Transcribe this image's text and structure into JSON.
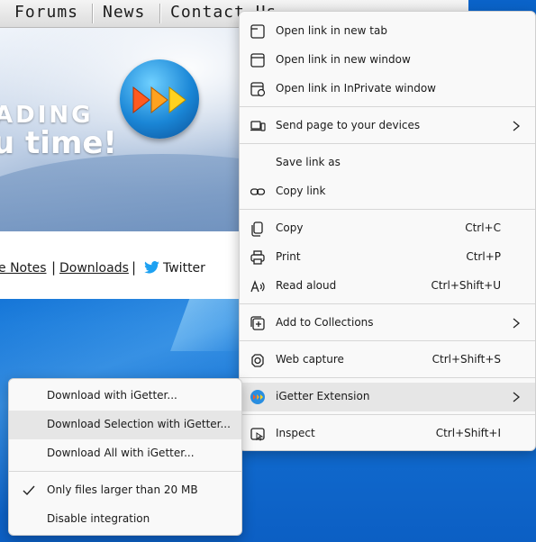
{
  "page": {
    "nav": [
      "Forums",
      "News",
      "Contact Us"
    ],
    "banner_line1": "ADING",
    "banner_line2": "u time!",
    "links": [
      "e Notes",
      "Downloads",
      "Twitter"
    ]
  },
  "context_menu": {
    "items": [
      {
        "label": "Open link in new tab",
        "icon": "new-tab-icon"
      },
      {
        "label": "Open link in new window",
        "icon": "new-window-icon"
      },
      {
        "label": "Open link in InPrivate window",
        "icon": "inprivate-icon"
      },
      {
        "label": "Send page to your devices",
        "icon": "devices-icon"
      },
      {
        "label": "Save link as"
      },
      {
        "label": "Copy link",
        "icon": "link-icon"
      },
      {
        "label": "Copy",
        "shortcut": "Ctrl+C",
        "icon": "copy-icon"
      },
      {
        "label": "Print",
        "shortcut": "Ctrl+P",
        "icon": "print-icon"
      },
      {
        "label": "Read aloud",
        "shortcut": "Ctrl+Shift+U",
        "icon": "read-aloud-icon"
      },
      {
        "label": "Add to Collections",
        "icon": "collections-icon"
      },
      {
        "label": "Web capture",
        "shortcut": "Ctrl+Shift+S",
        "icon": "web-capture-icon"
      },
      {
        "label": "iGetter Extension",
        "icon": "igetter-icon"
      },
      {
        "label": "Inspect",
        "shortcut": "Ctrl+Shift+I",
        "icon": "inspect-icon"
      }
    ]
  },
  "submenu": {
    "items": [
      {
        "label": "Download with iGetter..."
      },
      {
        "label": "Download Selection with iGetter..."
      },
      {
        "label": "Download All with iGetter..."
      },
      {
        "label": "Only files larger than 20 MB",
        "checked": true
      },
      {
        "label": "Disable integration"
      }
    ]
  },
  "colors": {
    "menu_bg": "#f9f9f9",
    "highlight": "#e6e6e6",
    "desktop": "#1576d8",
    "twitter": "#1da1f2"
  }
}
